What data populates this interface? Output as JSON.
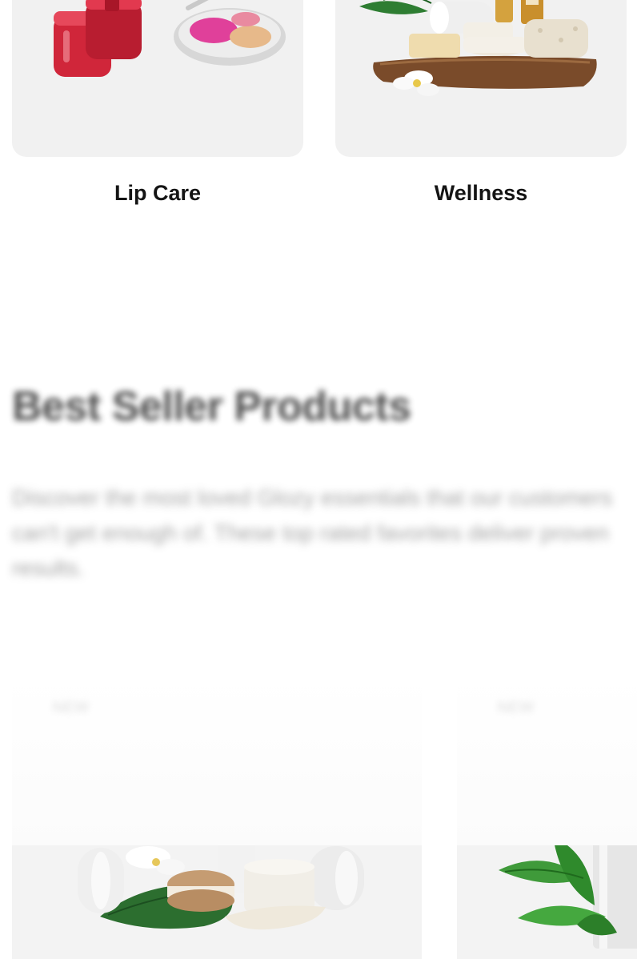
{
  "categories": [
    {
      "label": "Lip Care",
      "image": "lip-care-products-image"
    },
    {
      "label": "Wellness",
      "image": "wellness-spa-products-image"
    }
  ],
  "best_sellers": {
    "title": "Best Seller Products",
    "description": "Discover the most loved Glozy essentials that our customers can't get enough of. These top rated favorites deliver proven results."
  },
  "products": [
    {
      "badge": "NEW",
      "image": "spa-towels-and-cream-image"
    },
    {
      "badge": "NEW",
      "image": "green-leaves-bottle-image"
    }
  ]
}
